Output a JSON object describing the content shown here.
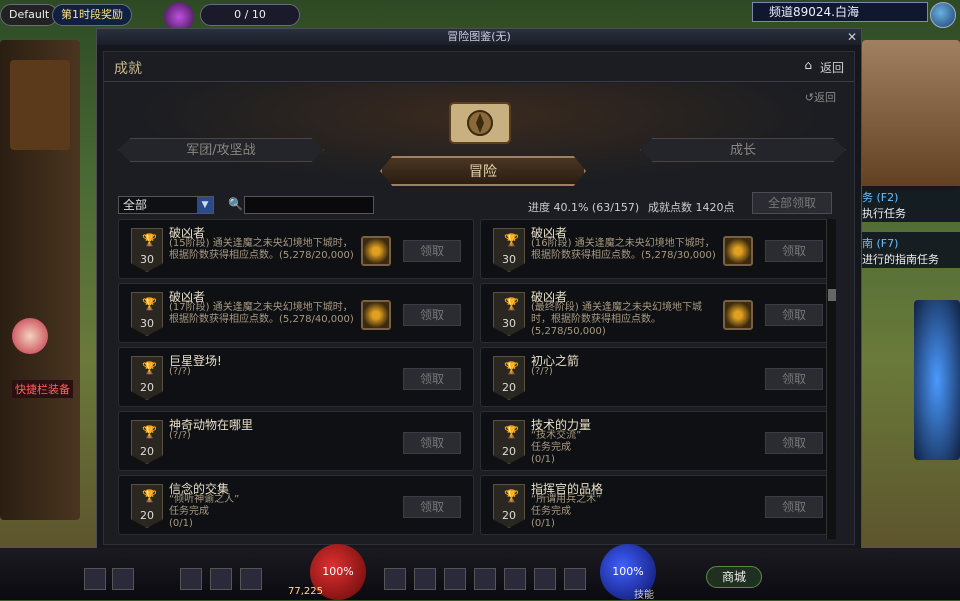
{
  "hud": {
    "default_label": "Default",
    "event_label": "第1时段奖励",
    "counter": "0 / 10",
    "channel": "频道89024.白海",
    "quest1_title": "务 (F2)",
    "quest1_text": "执行任务",
    "quest2_title": "南 (F7)",
    "quest2_text": "进行的指南任务",
    "quickbar_label": "快捷栏装备",
    "gold": "77,225",
    "hp": "100%",
    "mp": "100%",
    "mall": "商城",
    "skill_label": "技能"
  },
  "window": {
    "title": "冒险图鉴(无)",
    "header": "成就",
    "back": "返回",
    "back2": "返回",
    "categories": {
      "left": "军团/攻坚战",
      "mid": "冒险",
      "right": "成长"
    },
    "filter": "全部",
    "search_placeholder": "",
    "progress": "进度 40.1% (63/157)",
    "points": "成就点数 1420点",
    "claim_all": "全部领取"
  },
  "cards": [
    {
      "title": "破凶者",
      "desc": "(15阶段) 通关逢魔之未央幻境地下城时，根据阶数获得相应点数。(5,278/20,000)",
      "points": "30",
      "claim": "领取",
      "has_reward": true
    },
    {
      "title": "破凶者",
      "desc": "(16阶段) 通关逢魔之未央幻境地下城时，根据阶数获得相应点数。(5,278/30,000)",
      "points": "30",
      "claim": "领取",
      "has_reward": true
    },
    {
      "title": "破凶者",
      "desc": "(17阶段) 通关逢魔之未央幻境地下城时，根据阶数获得相应点数。(5,278/40,000)",
      "points": "30",
      "claim": "领取",
      "has_reward": true
    },
    {
      "title": "破凶者",
      "desc": "(最终阶段) 通关逢魔之未央幻境地下城时，根据阶数获得相应点数。(5,278/50,000)",
      "points": "30",
      "claim": "领取",
      "has_reward": true
    },
    {
      "title": "巨星登场!",
      "desc": "(?/?)",
      "points": "20",
      "claim": "领取",
      "has_reward": false
    },
    {
      "title": "初心之箭",
      "desc": "(?/?)",
      "points": "20",
      "claim": "领取",
      "has_reward": false
    },
    {
      "title": "神奇动物在哪里",
      "desc": "(?/?)",
      "points": "20",
      "claim": "领取",
      "has_reward": false
    },
    {
      "title": "技术的力量",
      "desc": "“技术交流”\n任务完成\n(0/1)",
      "points": "20",
      "claim": "领取",
      "has_reward": false
    },
    {
      "title": "信念的交集",
      "desc": "“倾听神谕之人”\n任务完成\n(0/1)",
      "points": "20",
      "claim": "领取",
      "has_reward": false
    },
    {
      "title": "指挥官的品格",
      "desc": "“所谓用兵之术”\n任务完成\n(0/1)",
      "points": "20",
      "claim": "领取",
      "has_reward": false
    }
  ],
  "colors": {
    "accent": "#c8a050",
    "frame": "#1b1d22"
  }
}
